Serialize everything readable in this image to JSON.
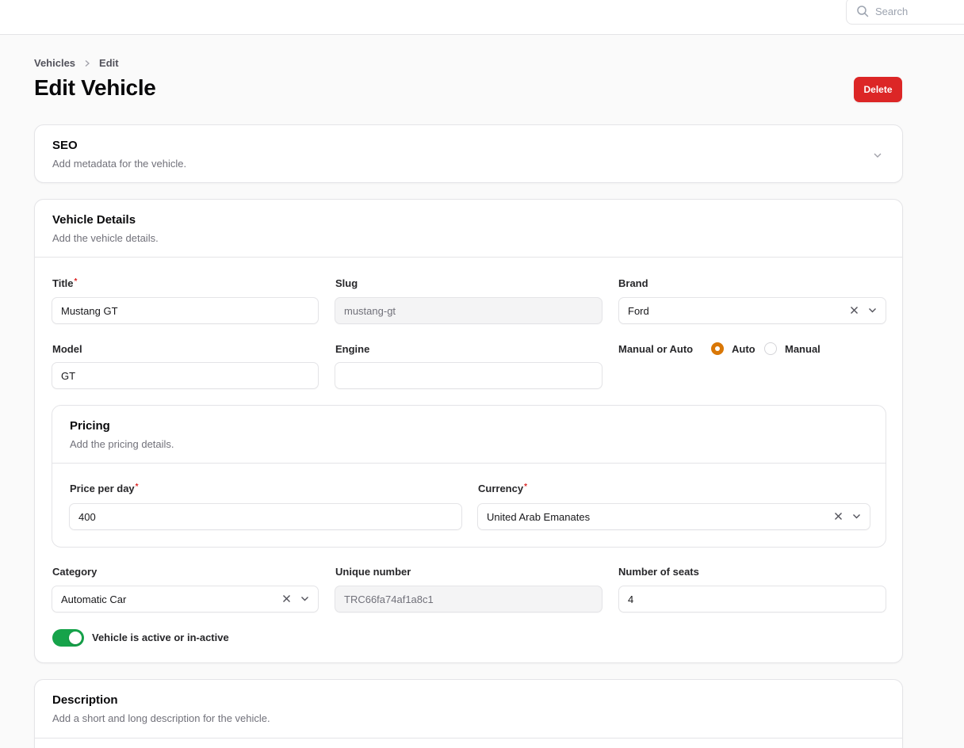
{
  "search": {
    "placeholder": "Search"
  },
  "breadcrumb": {
    "items": [
      "Vehicles",
      "Edit"
    ]
  },
  "header": {
    "title": "Edit Vehicle",
    "delete_label": "Delete"
  },
  "seo": {
    "title": "SEO",
    "description": "Add metadata for the vehicle."
  },
  "details": {
    "title": "Vehicle Details",
    "description": "Add the vehicle details.",
    "fields": {
      "title": {
        "label": "Title",
        "value": "Mustang GT"
      },
      "slug": {
        "label": "Slug",
        "value": "mustang-gt"
      },
      "brand": {
        "label": "Brand",
        "value": "Ford"
      },
      "model": {
        "label": "Model",
        "value": "GT"
      },
      "engine": {
        "label": "Engine",
        "value": ""
      },
      "transmission": {
        "label": "Manual or Auto",
        "options": [
          "Auto",
          "Manual"
        ],
        "selected": "Auto"
      },
      "category": {
        "label": "Category",
        "value": "Automatic Car"
      },
      "unique_number": {
        "label": "Unique number",
        "value": "TRC66fa74af1a8c1"
      },
      "seats": {
        "label": "Number of seats",
        "value": "4"
      },
      "active": {
        "label": "Vehicle is active or in-active",
        "on": true
      }
    }
  },
  "pricing": {
    "title": "Pricing",
    "description": "Add the pricing details.",
    "price": {
      "label": "Price per day",
      "value": "400"
    },
    "currency": {
      "label": "Currency",
      "value": "United Arab Emanates"
    }
  },
  "description_section": {
    "title": "Description",
    "description": "Add a short and long description for the vehicle."
  },
  "colors": {
    "primary": "#d97706",
    "danger": "#dc2626",
    "success": "#16a34a"
  }
}
